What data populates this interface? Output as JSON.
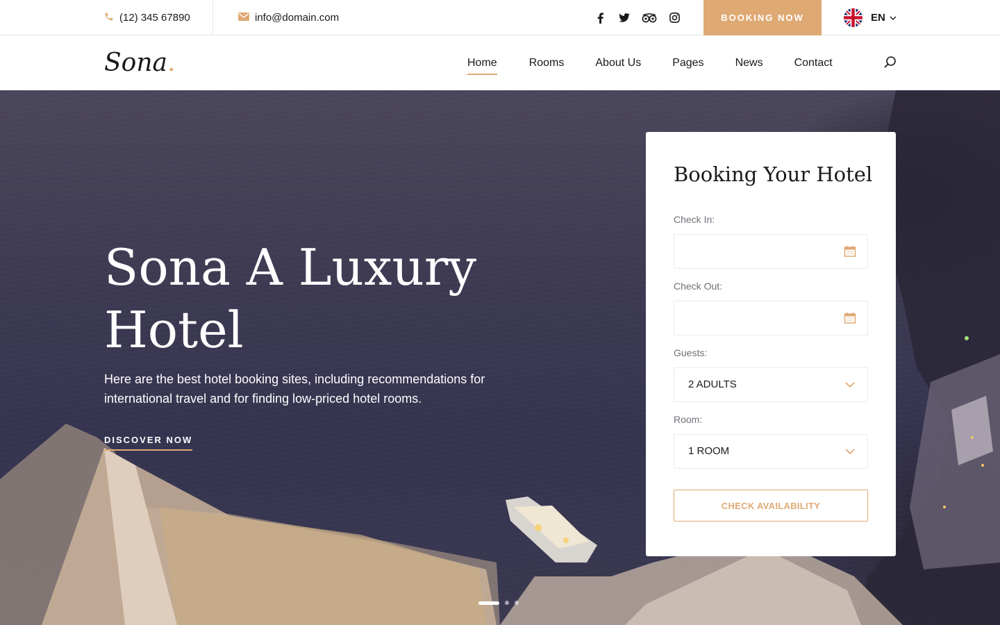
{
  "topbar": {
    "phone": "(12) 345 67890",
    "email": "info@domain.com",
    "social": [
      "facebook-icon",
      "twitter-icon",
      "tripadvisor-icon",
      "instagram-icon"
    ],
    "booking_label": "BOOKING NOW",
    "language": "EN"
  },
  "nav": {
    "logo": "Sona",
    "logo_dot": ".",
    "items": [
      {
        "label": "Home",
        "active": true
      },
      {
        "label": "Rooms"
      },
      {
        "label": "About Us"
      },
      {
        "label": "Pages"
      },
      {
        "label": "News"
      },
      {
        "label": "Contact"
      }
    ]
  },
  "hero": {
    "title_line1": "Sona A Luxury",
    "title_line2": "Hotel",
    "text": "Here are the best hotel booking sites, including recommendations for international travel and for finding low-priced hotel rooms.",
    "cta": "DISCOVER NOW",
    "slides": 3,
    "active_slide": 1
  },
  "booking": {
    "title": "Booking Your Hotel",
    "check_in_label": "Check In:",
    "check_in_value": "",
    "check_out_label": "Check Out:",
    "check_out_value": "",
    "guests_label": "Guests:",
    "guests_value": "2 ADULTS",
    "room_label": "Room:",
    "room_value": "1 ROOM",
    "submit_label": "CHECK AVAILABILITY"
  },
  "colors": {
    "accent": "#dfa974",
    "text": "#19191a",
    "muted": "#707079"
  }
}
